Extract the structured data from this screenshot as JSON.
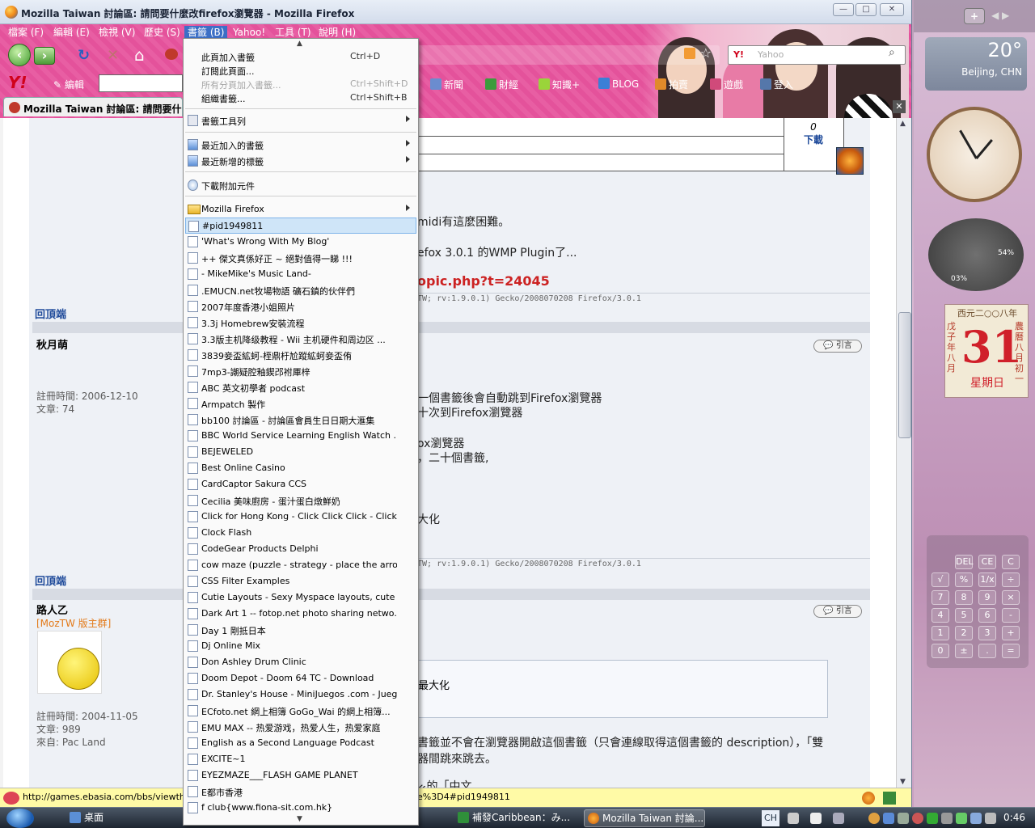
{
  "window": {
    "title": "Mozilla Taiwan 討論區: 請問要什麼改firefox瀏覽器 - Mozilla Firefox"
  },
  "menubar": [
    "檔案 (F)",
    "編輯 (E)",
    "檢視 (V)",
    "歷史 (S)",
    "書籤 (B)",
    "Yahoo!",
    "工具 (T)",
    "說明 (H)"
  ],
  "search": {
    "placeholder": "Yahoo"
  },
  "yahoo_toolbar": {
    "edit_label": "編輯",
    "items": [
      "新聞",
      "財經",
      "知識+",
      "BLOG",
      "拍賣",
      "遊戲",
      "登入"
    ]
  },
  "tab": {
    "title": "Mozilla Taiwan 討論區: 請問要什..."
  },
  "page": {
    "download_label": "下載",
    "download_count": "0",
    "back_to_top": "回頂端",
    "quote_label": "引言",
    "post_lines": [
      "midi有這麼困難。",
      "efox 3.0.1 的WMP Plugin了...",
      "opic.php?t=24045"
    ],
    "signature": "TW; rv:1.9.0.1) Gecko/2008070208 Firefox/3.0.1",
    "user1": {
      "name": "秋月萌",
      "reg": "註冊時間: 2006-12-10",
      "posts": "文章: 74"
    },
    "post2_lines": [
      "一個書籤後會自動跳到Firefox瀏覽器",
      "十次到Firefox瀏覽器",
      "ox瀏覽器",
      "，二十個書籤,",
      "大化"
    ],
    "user2": {
      "name": "路人乙",
      "rank": "[MozTW 版主群]",
      "reg": "註冊時間: 2004-11-05",
      "posts": "文章: 989",
      "from": "來自: Pac Land"
    },
    "quote_text": "最大化",
    "post3_lines": [
      "書籤並不會在瀏覽器開啟這個書籤（只會連線取得這個書籤的 description），「雙",
      "器間跳來跳去。",
      "ᨀ的「中文"
    ]
  },
  "statusbar": {
    "url_left": "http://games.ebasia.com/bbs/viewthre",
    "url_right": "e%3D4#pid1949811"
  },
  "bookmarks_menu": {
    "scroll_up": "▲",
    "scroll_down": "▼",
    "top_items": [
      {
        "label": "此頁加入書籤",
        "accel": "Ctrl+D",
        "disabled": false
      },
      {
        "label": "訂閱此頁面...",
        "accel": "",
        "disabled": false
      },
      {
        "label": "所有分頁加入書籤...",
        "accel": "Ctrl+Shift+D",
        "disabled": true
      },
      {
        "label": "組織書籤...",
        "accel": "Ctrl+Shift+B",
        "disabled": false
      }
    ],
    "toolbar_item": "書籤工具列",
    "recent_items": [
      "最近加入的書籤",
      "最近新增的標籤"
    ],
    "addons_item": "下載附加元件",
    "folder_item": "Mozilla Firefox",
    "bookmarks": [
      "#pid1949811",
      "'What's Wrong With My Blog'",
      "++ 傑文真係好正 ~ 絕對值得一睇 !!!",
      "- MikeMike's Music Land-",
      ".EMUCN.net牧場物語 礦石鎮的伙伴們",
      "2007年度香港小姐照片",
      "3.3j Homebrew安裝流程",
      "3.3版主机降级教程 - Wii 主机硬件和周边区 ...",
      "3839妾盃絋蚵-桎鼎杅尬蹤絋蚵妾盃侑",
      "7mp3-謿疑腔釉鍥邔祔厙梓",
      "ABC 英文初學者 podcast",
      "Armpatch 製作",
      "bb100 討論區 - 討論區會員生日日期大滙集",
      "BBC World Service  Learning English  Watch ...",
      "BEJEWELED",
      "Best Online Casino",
      "CardCaptor Sakura CCS",
      "Cecilia 美味廚房 - 蛋汁蛋白燉鮮奶",
      "Click for Hong Kong - Click Click Click - Click...",
      "Clock Flash",
      "CodeGear  Products  Delphi",
      "cow maze (puzzle - strategy - place the arrow...",
      "CSS Filter Examples",
      "Cutie Layouts - Sexy Myspace layouts, cute M...",
      "Dark Art  1 -- fotop.net photo sharing netwo...",
      "Day 1 剛抵日本",
      "Dj Online Mix",
      "Don Ashley Drum Clinic",
      "Doom Depot - Doom 64 TC - Download",
      "Dr. Stanley's House - MiniJuegos .com - Jueg...",
      "ECfoto.net 網上相簿  GoGo_Wai 的網上相簿...",
      "EMU MAX -- 热爱游戏，热爱人生，热爱家庭",
      "English as a Second Language Podcast",
      "EXCITE~1",
      "EYEZMAZE___FLASH GAME PLANET",
      "E都市香港",
      "f club{www.fiona-sit.com.hk}"
    ]
  },
  "sidebar": {
    "weather_temp": "20°",
    "weather_city": "Beijing, CHN",
    "meter_left": "03%",
    "meter_right": "54%",
    "calendar_year": "西元二○○八年",
    "calendar_day": "31",
    "calendar_weekday": "星期日",
    "calendar_left": "戊子年 八月",
    "calendar_right": "農曆八月初一",
    "calc_keys": [
      "DEL",
      "CE",
      "C",
      "√",
      "%",
      "1/x",
      "÷",
      "7",
      "8",
      "9",
      "×",
      "4",
      "5",
      "6",
      "-",
      "1",
      "2",
      "3",
      "+",
      "0",
      "±",
      ".",
      "="
    ]
  },
  "taskbar": {
    "items": [
      "桌面",
      "",
      "補發Caribbean：み...",
      "Mozilla Taiwan 討論..."
    ],
    "lang": "CH",
    "time": "0:46"
  }
}
